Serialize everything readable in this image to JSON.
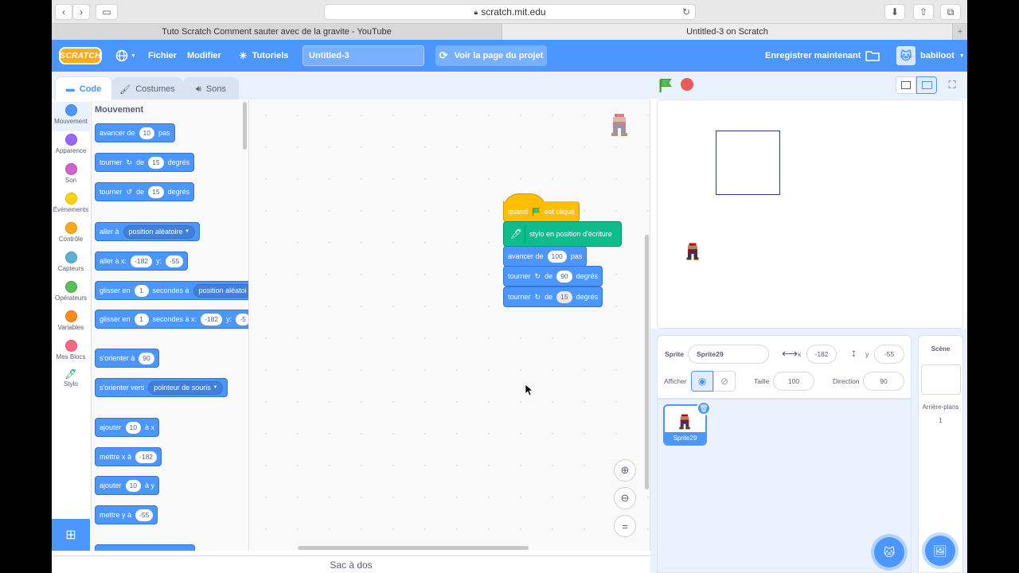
{
  "browser": {
    "url": "scratch.mit.edu",
    "tabs": [
      {
        "label": "Tuto Scratch Comment sauter avec de la gravite - YouTube",
        "active": false
      },
      {
        "label": "Untitled-3 on Scratch",
        "active": true
      }
    ]
  },
  "menubar": {
    "logo": "SCRATCH",
    "file": "Fichier",
    "edit": "Modifier",
    "tutorials": "Tutoriels",
    "project_title": "Untitled-3",
    "see_project": "Voir la page du projet",
    "save_now": "Enregistrer maintenant",
    "username": "babiloot"
  },
  "editor_tabs": {
    "code": "Code",
    "costumes": "Costumes",
    "sounds": "Sons"
  },
  "categories": [
    {
      "label": "Mouvement",
      "color": "#4c97ff"
    },
    {
      "label": "Apparence",
      "color": "#9966ff"
    },
    {
      "label": "Son",
      "color": "#cf63cf"
    },
    {
      "label": "Événements",
      "color": "#ffd500"
    },
    {
      "label": "Contrôle",
      "color": "#ffab19"
    },
    {
      "label": "Capteurs",
      "color": "#5cb1d6"
    },
    {
      "label": "Opérateurs",
      "color": "#59c059"
    },
    {
      "label": "Variables",
      "color": "#ff8c1a"
    },
    {
      "label": "Mes Blocs",
      "color": "#ff6680"
    },
    {
      "label": "Stylo",
      "color": "#0fbd8c"
    }
  ],
  "palette": {
    "title": "Mouvement",
    "move_a": "avancer de",
    "move_v": "10",
    "move_b": "pas",
    "turn_r_a": "tourner",
    "turn_r_b": "de",
    "turn_r_v": "15",
    "turn_r_c": "degrés",
    "turn_l_a": "tourner",
    "turn_l_b": "de",
    "turn_l_v": "15",
    "turn_l_c": "degrés",
    "goto_a": "aller à",
    "goto_dd": "position aléatoire",
    "gotoxy_a": "aller à x:",
    "gotoxy_x": "-182",
    "gotoxy_b": "y:",
    "gotoxy_y": "-55",
    "glide_a": "glisser en",
    "glide_v": "1",
    "glide_b": "secondes à",
    "glide_dd": "position aléatoi",
    "glidexy_a": "glisser en",
    "glidexy_v": "1",
    "glidexy_b": "secondes à x:",
    "glidexy_x": "-182",
    "glidexy_c": "y:",
    "glidexy_y": "-5",
    "point_a": "s'orienter à",
    "point_v": "90",
    "pointto_a": "s'orienter vers",
    "pointto_dd": "pointeur de souris",
    "changex_a": "ajouter",
    "changex_v": "10",
    "changex_b": "à x",
    "setx_a": "mettre x à",
    "setx_v": "-182",
    "changey_a": "ajouter",
    "changey_v": "10",
    "changey_b": "à y",
    "sety_a": "mettre y à",
    "sety_v": "-55"
  },
  "script": {
    "hat_a": "quand",
    "hat_b": "est cliqué",
    "pendown": "stylo en position d'écriture",
    "move_a": "avancer de",
    "move_v": "100",
    "move_b": "pas",
    "turn1_a": "tourner",
    "turn1_b": "de",
    "turn1_v": "90",
    "turn1_c": "degrés",
    "turn2_a": "tourner",
    "turn2_b": "de",
    "turn2_v": "15",
    "turn2_c": "degrés"
  },
  "backpack": "Sac à dos",
  "sprite_info": {
    "sprite_label": "Sprite",
    "sprite_name": "Sprite29",
    "x_label": "x",
    "x_value": "-182",
    "y_label": "y",
    "y_value": "-55",
    "show_label": "Afficher",
    "size_label": "Taille",
    "size_value": "100",
    "direction_label": "Direction",
    "direction_value": "90"
  },
  "sprite_list": [
    {
      "name": "Sprite29",
      "selected": true
    }
  ],
  "stage_panel": {
    "title": "Scène",
    "backdrops_label": "Arrière-plans",
    "backdrops_count": "1"
  }
}
